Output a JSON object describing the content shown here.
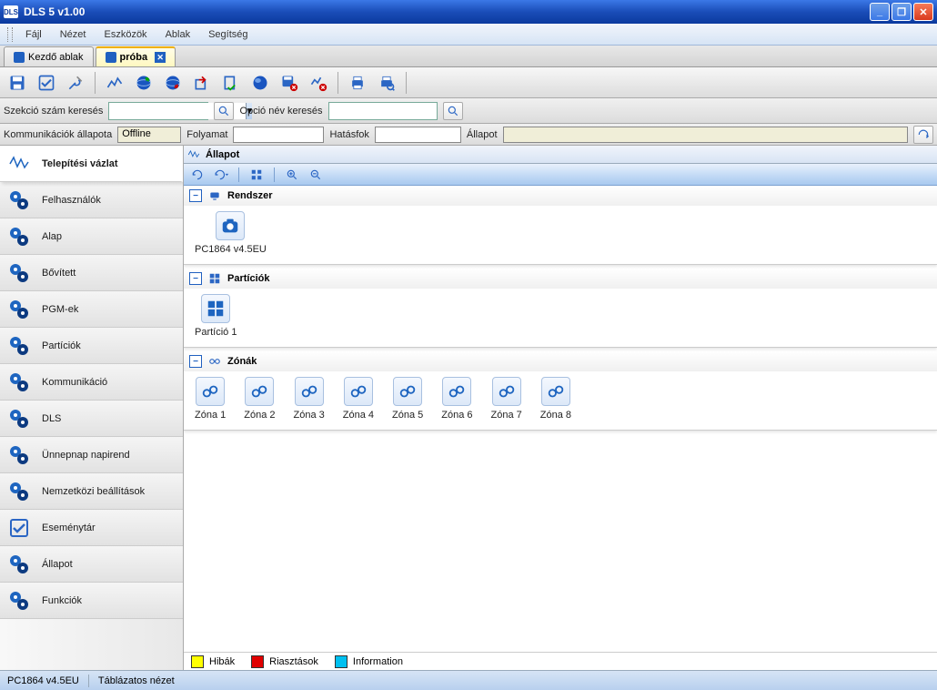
{
  "window": {
    "title": "DLS 5 v1.00"
  },
  "menu": {
    "items": [
      "Fájl",
      "Nézet",
      "Eszközök",
      "Ablak",
      "Segítség"
    ]
  },
  "tabs": [
    {
      "label": "Kezdő ablak",
      "active": false
    },
    {
      "label": "próba",
      "active": true
    }
  ],
  "search": {
    "section_label": "Szekció szám keresés",
    "option_label": "Opció név keresés"
  },
  "comm": {
    "status_label": "Kommunikációk állapota",
    "status_value": "Offline",
    "process_label": "Folyamat",
    "process_value": "",
    "scope_label": "Hatásfok",
    "scope_value": "",
    "state_label": "Állapot",
    "state_value": ""
  },
  "sidebar": {
    "items": [
      "Telepítési vázlat",
      "Felhasználók",
      "Alap",
      "Bővített",
      "PGM-ek",
      "Partíciók",
      "Kommunikáció",
      "DLS",
      "Ünnepnap napirend",
      "Nemzetközi beállítások",
      "Eseménytár",
      "Állapot",
      "Funkciók"
    ]
  },
  "content": {
    "header": "Állapot",
    "sections": {
      "system": {
        "title": "Rendszer",
        "items": [
          "PC1864 v4.5EU"
        ]
      },
      "partitions": {
        "title": "Partíciók",
        "items": [
          "Partíció 1"
        ]
      },
      "zones": {
        "title": "Zónák",
        "items": [
          "Zóna 1",
          "Zóna 2",
          "Zóna 3",
          "Zóna 4",
          "Zóna 5",
          "Zóna 6",
          "Zóna 7",
          "Zóna 8"
        ]
      }
    }
  },
  "legend": {
    "errors": {
      "label": "Hibák",
      "color": "#ffff00"
    },
    "alarms": {
      "label": "Riasztások",
      "color": "#e00000"
    },
    "info": {
      "label": "Information",
      "color": "#00c0f0"
    }
  },
  "footer": {
    "model": "PC1864 v4.5EU",
    "view": "Táblázatos nézet"
  }
}
